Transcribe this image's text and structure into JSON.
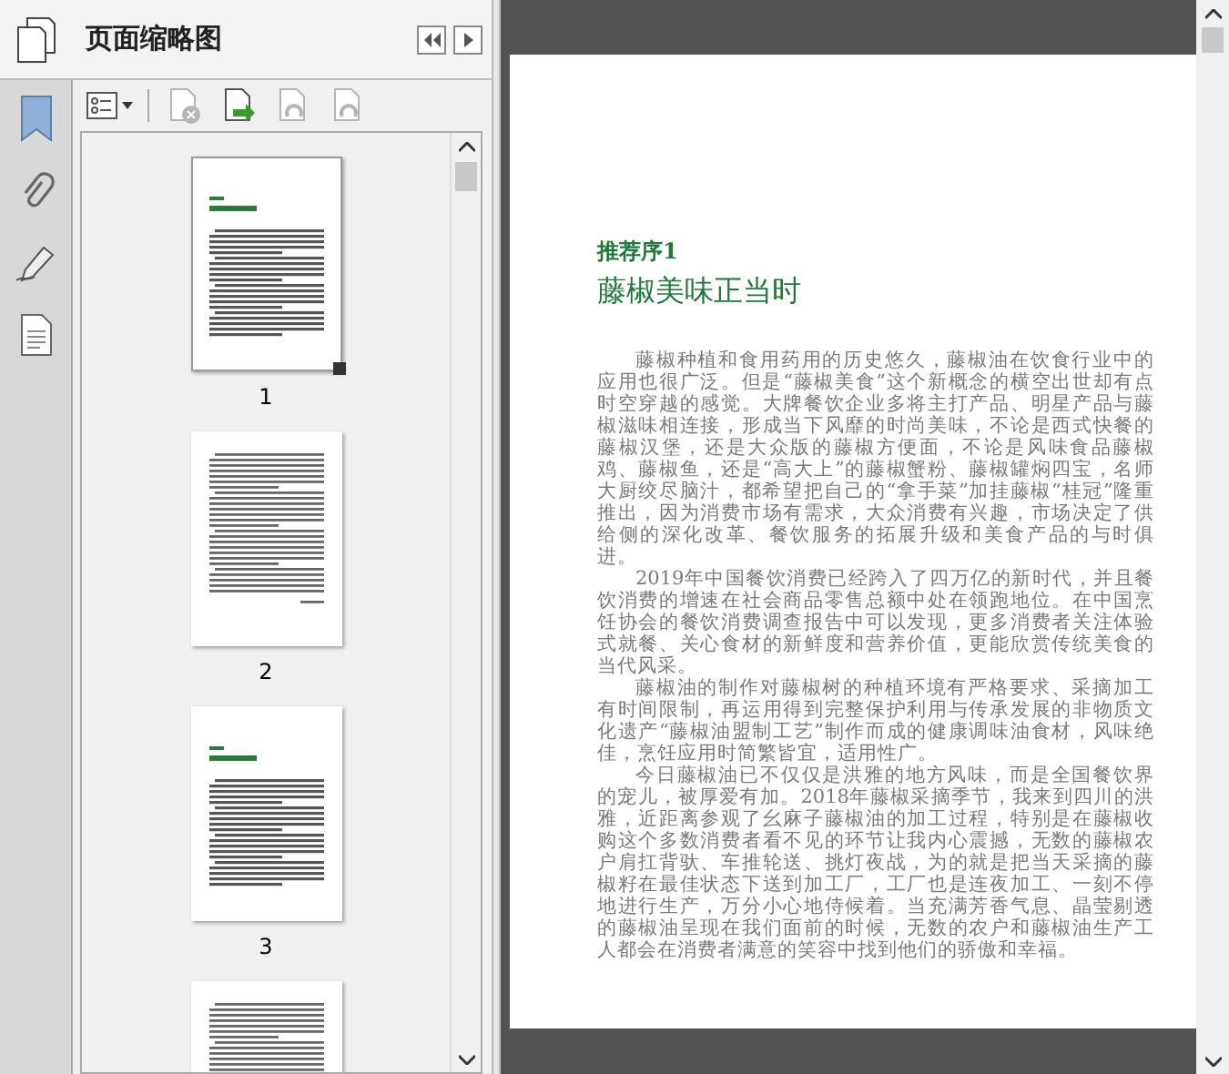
{
  "panel": {
    "title": "页面缩略图",
    "toolbar": [
      {
        "kind": "options",
        "disabled": false
      },
      {
        "kind": "delete",
        "disabled": true
      },
      {
        "kind": "insert",
        "disabled": false
      },
      {
        "kind": "undo",
        "disabled": true
      },
      {
        "kind": "redo",
        "disabled": true
      }
    ]
  },
  "side_tools": [
    {
      "kind": "bookmark"
    },
    {
      "kind": "attachment"
    },
    {
      "kind": "signature"
    },
    {
      "kind": "document"
    }
  ],
  "thumbnails": [
    {
      "label": "1",
      "kind": "title-page",
      "selected": true
    },
    {
      "label": "2",
      "kind": "text-page",
      "selected": false
    },
    {
      "label": "3",
      "kind": "title-page",
      "selected": false
    },
    {
      "kind": "text-page",
      "selected": false
    }
  ],
  "page": {
    "subtitle": "推荐序1",
    "title": "藤椒美味正当时",
    "paragraphs": [
      "藤椒种植和食用药用的历史悠久，藤椒油在饮食行业中的应用也很广泛。但是“藤椒美食”这个新概念的横空出世却有点时空穿越的感觉。大牌餐饮企业多将主打产品、明星产品与藤椒滋味相连接，形成当下风靡的时尚美味，不论是西式快餐的藤椒汉堡，还是大众版的藤椒方便面，不论是风味食品藤椒鸡、藤椒鱼，还是“高大上”的藤椒蟹粉、藤椒罐焖四宝，名师大厨绞尽脑汁，都希望把自己的“拿手菜”加挂藤椒“桂冠”隆重推出，因为消费市场有需求，大众消费有兴趣，市场决定了供给侧的深化改革、餐饮服务的拓展升级和美食产品的与时俱进。",
      "2019年中国餐饮消费已经跨入了四万亿的新时代，并且餐饮消费的增速在社会商品零售总额中处在领跑地位。在中国烹饪协会的餐饮消费调查报告中可以发现，更多消费者关注体验式就餐、关心食材的新鲜度和营养价值，更能欣赏传统美食的当代风采。",
      "藤椒油的制作对藤椒树的种植环境有严格要求、采摘加工有时间限制，再运用得到完整保护利用与传承发展的非物质文化遗产“藤椒油盟制工艺”制作而成的健康调味油食材，风味绝佳，烹饪应用时简繁皆宜，适用性广。",
      "今日藤椒油已不仅仅是洪雅的地方风味，而是全国餐饮界的宠儿，被厚爱有加。2018年藤椒采摘季节，我来到四川的洪雅，近距离参观了幺麻子藤椒油的加工过程，特别是在藤椒收购这个多数消费者看不见的环节让我内心震撼，无数的藤椒农户肩扛背驮、车推轮送、挑灯夜战，为的就是把当天采摘的藤椒籽在最佳状态下送到加工厂，工厂也是连夜加工、一刻不停地进行生产，万分小心地侍候着。当充满芳香气息、晶莹剔透的藤椒油呈现在我们面前的时候，无数的农户和藤椒油生产工人都会在消费者满意的笑容中找到他们的骄傲和幸福。"
    ]
  }
}
